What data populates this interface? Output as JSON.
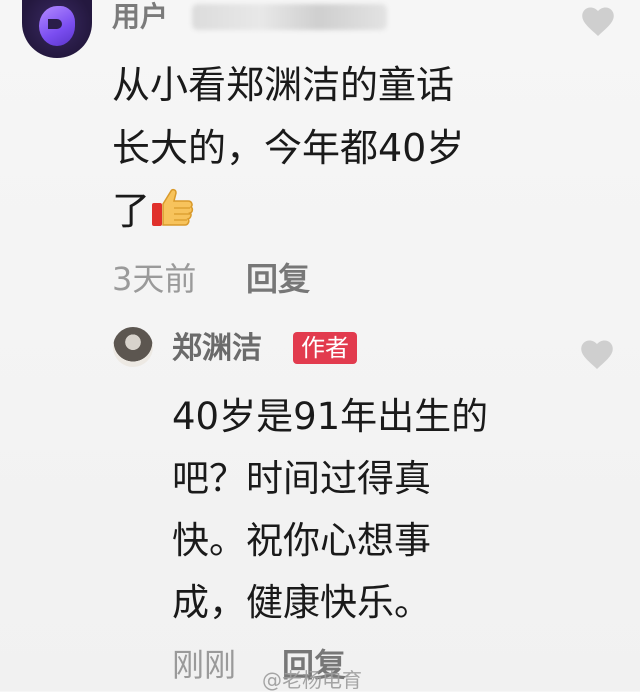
{
  "comment": {
    "username": "用户",
    "text_lines": [
      "从小看郑渊洁的童话",
      "长大的，今年都40岁",
      "了"
    ],
    "time": "3天前",
    "reply_label": "回复"
  },
  "reply": {
    "author": "郑渊洁",
    "badge": "作者",
    "text_lines": [
      "40岁是91年出生的",
      "吧？时间过得真",
      "快。祝你心想事",
      "成，健康快乐。"
    ],
    "time": "刚刚",
    "reply_label": "回复"
  },
  "watermark": "@老杨电育",
  "colors": {
    "badge": "#e23b4e",
    "heart": "#cccccc",
    "meta": "#9a9a9a"
  },
  "icons": {
    "like": "heart-icon",
    "emoji": "thumbs-up-icon"
  }
}
